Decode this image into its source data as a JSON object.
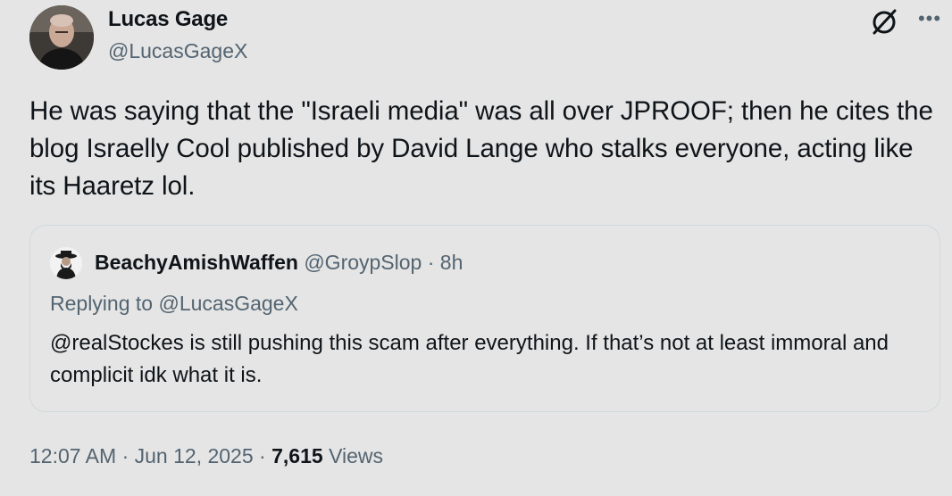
{
  "author": {
    "name": "Lucas Gage",
    "handle": "@LucasGageX"
  },
  "tweet": {
    "text": "He was saying that the \"Israeli media\" was all over JPROOF; then he cites the blog Israelly Cool published by David Lange who stalks everyone, acting like its Haaretz lol."
  },
  "quoted": {
    "name": "BeachyAmishWaffen",
    "handle": "@GroypSlop",
    "separator": "·",
    "time": "8h",
    "replying_prefix": "Replying to",
    "replying_to": "@LucasGageX",
    "text": "@realStockes is still pushing this scam after everything. If that’s not at least immoral and complicit idk what it is."
  },
  "meta": {
    "time": "12:07 AM",
    "sep1": "·",
    "date": "Jun 12, 2025",
    "sep2": "·",
    "views_count": "7,615",
    "views_label": "Views"
  },
  "icons": {
    "grok": "grok-icon",
    "more": "more-options-icon"
  },
  "colors": {
    "background": "#e5e5e5",
    "text": "#0f1419",
    "secondary": "#536471",
    "border": "#cfd9de"
  }
}
